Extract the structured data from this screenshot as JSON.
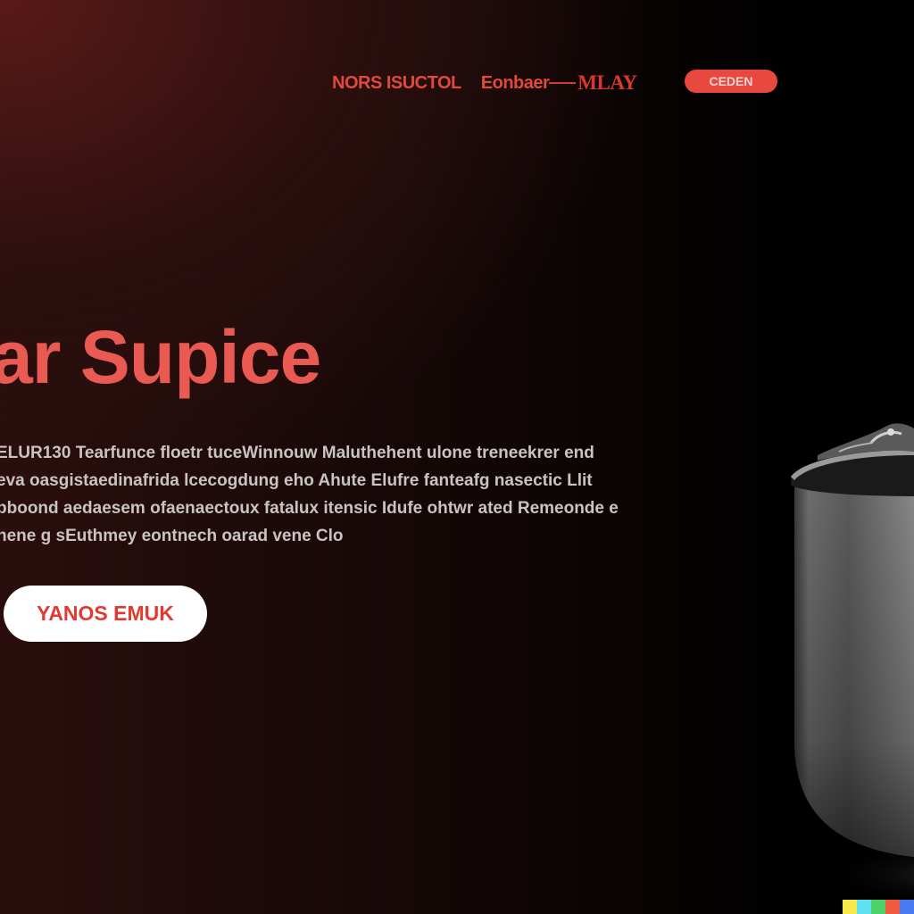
{
  "nav": {
    "links": [
      "NORS ISUCTOL",
      "Eonbaer",
      "MLAY"
    ],
    "cta_label": "CEDEN"
  },
  "hero": {
    "title": "ar Supice",
    "body_lines": [
      "ELUR130 Tearfunce floetr tuceWinnouw Maluthehent ulone treneekrer end",
      "eva oasgistaedinafrida lcecogdung eho Ahute Elufre fanteafg nasectic Llit",
      "bboond aedaesem ofaenaectoux fatalux itensic Idufe ohtwr ated Remeonde e",
      "nene g sEuthmey eontnech oarad vene Clo"
    ],
    "button_label": "YANOS EMUK"
  },
  "product_icon": "pot-icon",
  "colors": {
    "accent": "#e8483d",
    "title": "#e85a52",
    "background_dark": "#000000",
    "background_warm": "#5a1a17",
    "strip": [
      "#f7e84a",
      "#5ee0f0",
      "#4bd36a",
      "#f05a3c",
      "#4a7af0"
    ]
  }
}
